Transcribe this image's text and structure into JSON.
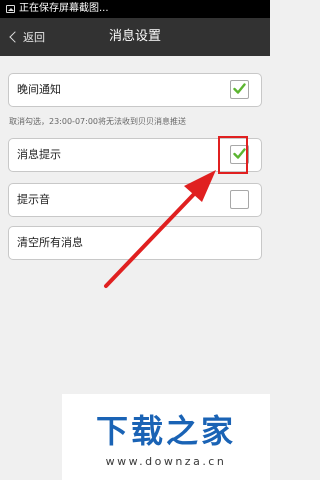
{
  "status_bar": {
    "text": "正在保存屏幕截图..."
  },
  "header": {
    "back_label": "返回",
    "title": "消息设置"
  },
  "settings": {
    "night_notify": {
      "label": "晚间通知",
      "checked": true
    },
    "hint": "取消勾选，23:00-07:00将无法收到贝贝消息推送",
    "message_alert": {
      "label": "消息提示",
      "checked": true
    },
    "alert_sound": {
      "label": "提示音",
      "checked": false
    },
    "clear_all": {
      "label": "清空所有消息"
    }
  },
  "annotation": {
    "color": "#e02020"
  },
  "watermark": {
    "title": "下载之家",
    "url": "www.downza.cn"
  },
  "colors": {
    "title_bar": "#323232",
    "check_green": "#5cb531",
    "watermark_blue": "#1a63b5"
  }
}
